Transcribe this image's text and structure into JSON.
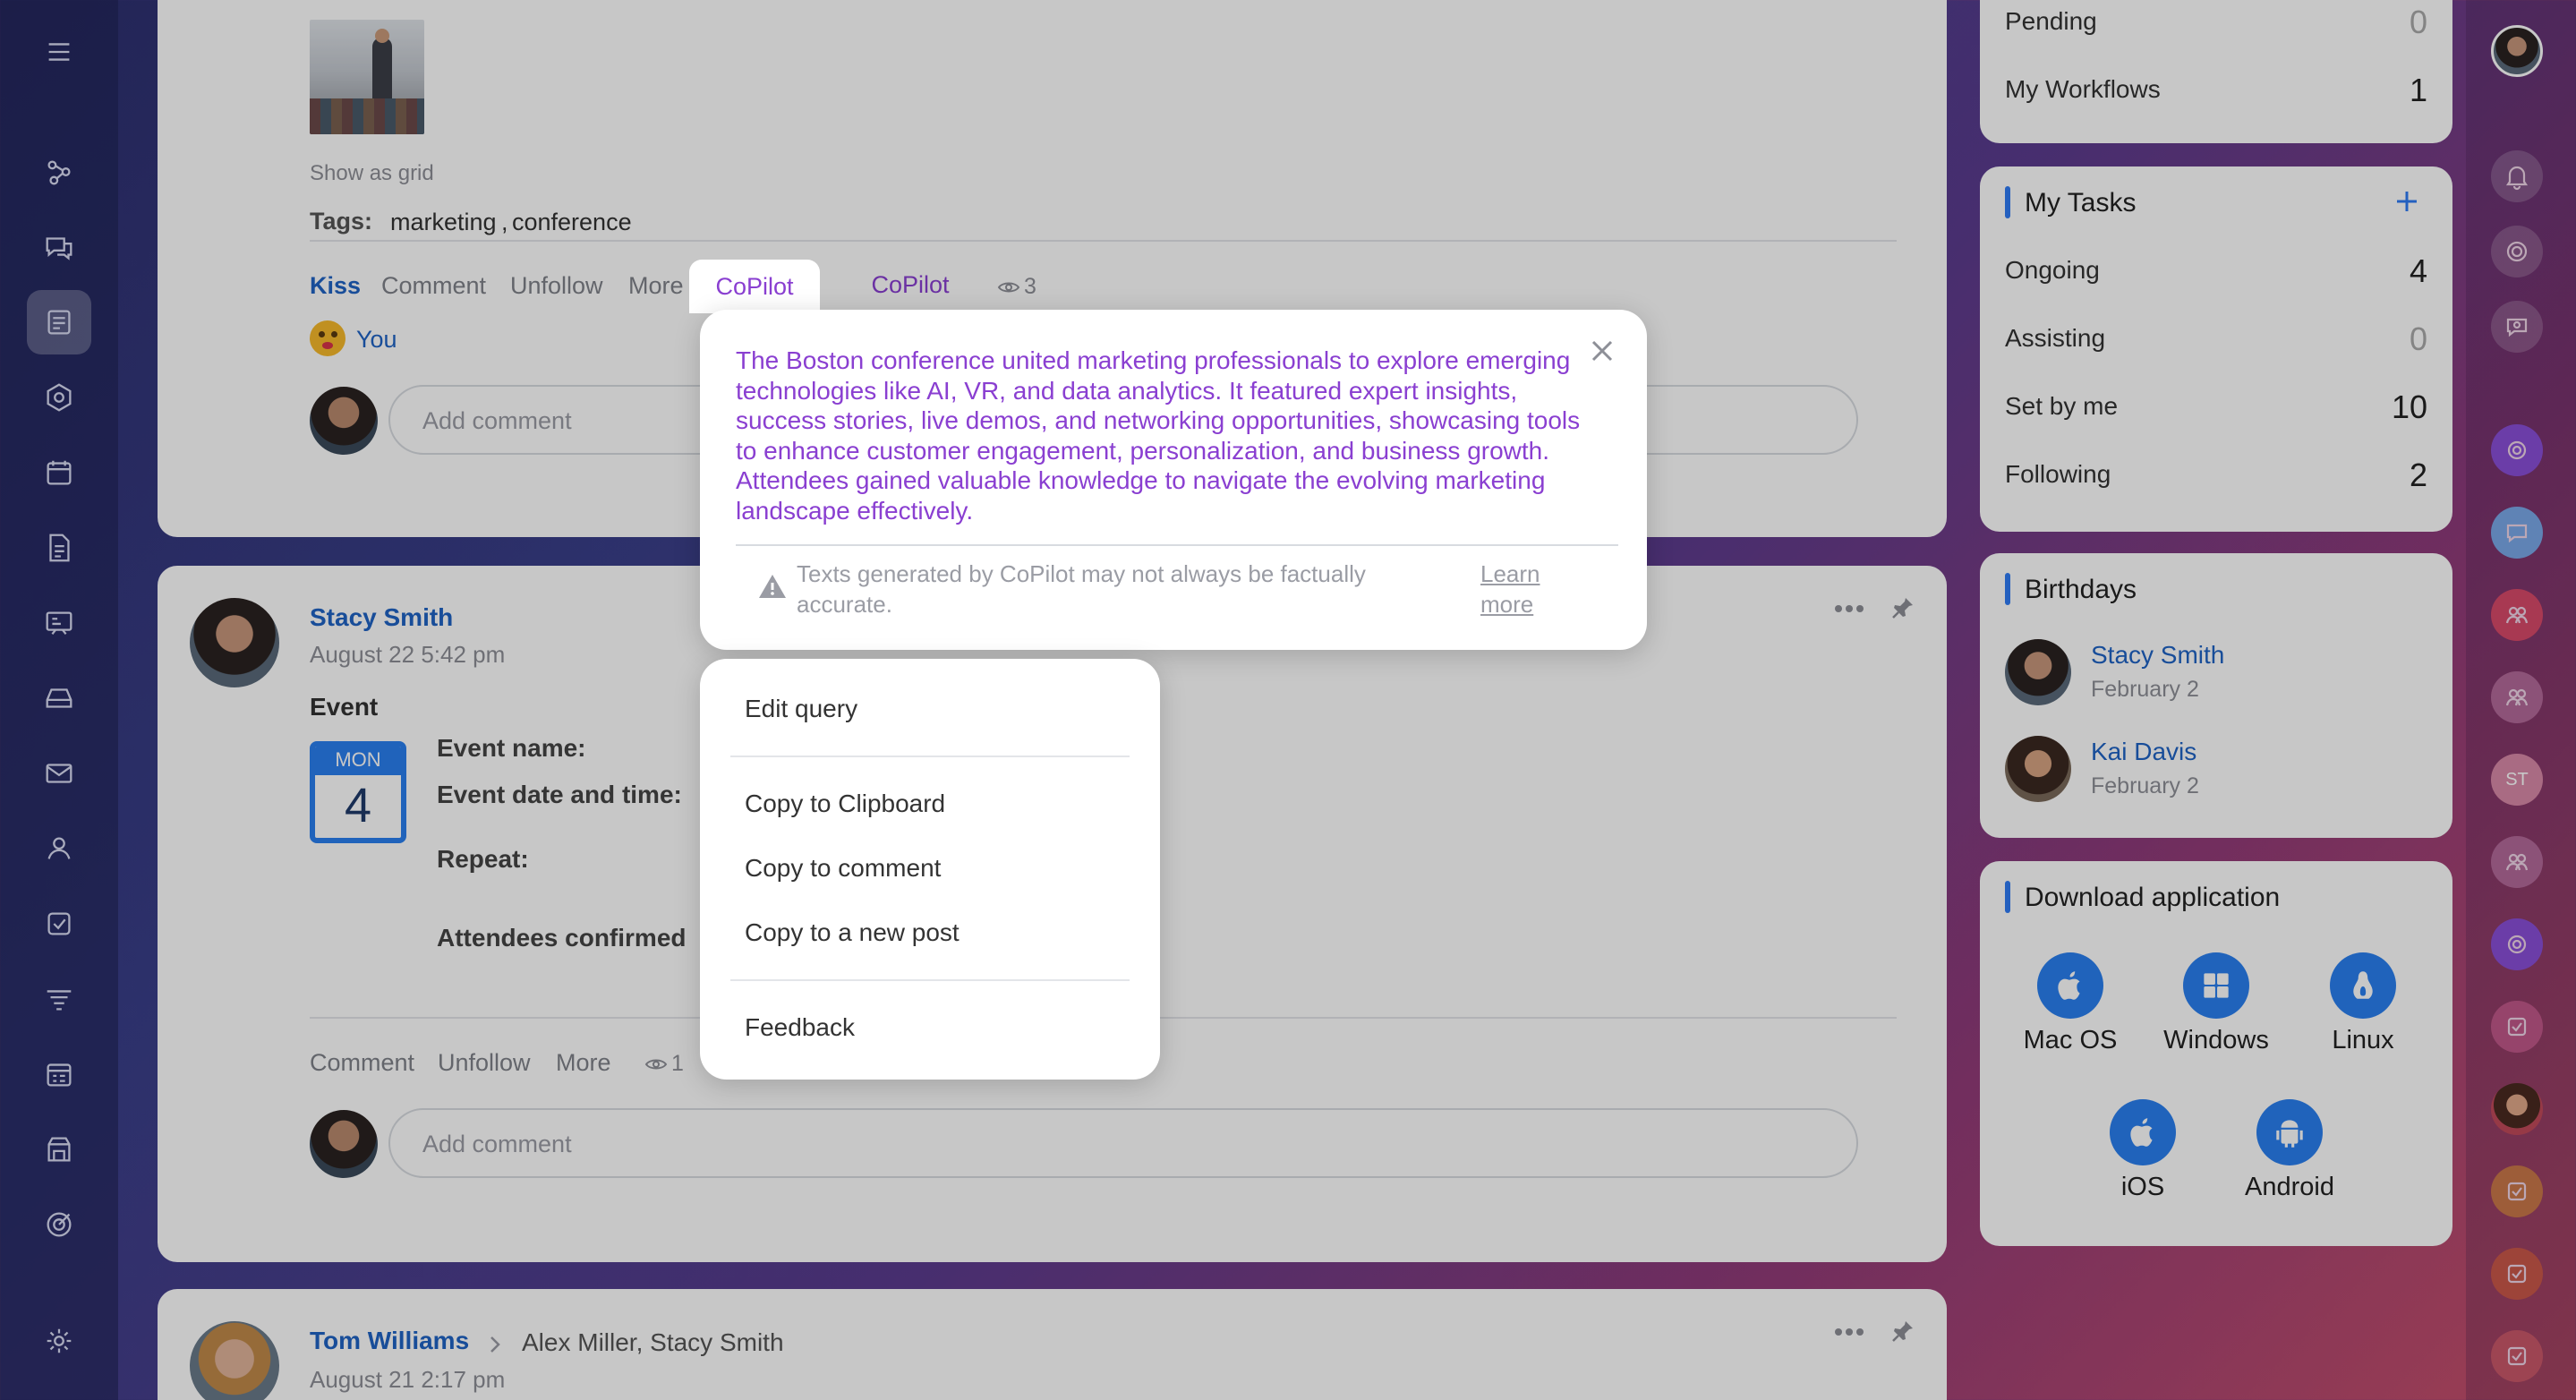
{
  "feed": {
    "post1": {
      "show_as_grid": "Show as grid",
      "tags_label": "Tags:",
      "tags": [
        "marketing",
        "conference"
      ],
      "tag_separator": ",",
      "actions": {
        "kiss": "Kiss",
        "comment": "Comment",
        "unfollow": "Unfollow",
        "more": "More",
        "copilot": "CoPilot",
        "views": "3"
      },
      "reaction_user": "You",
      "comment_placeholder": "Add comment"
    },
    "post2": {
      "author": "Stacy Smith",
      "date": "August 22 5:42 pm",
      "type": "Event",
      "calendar": {
        "day_name": "MON",
        "day_num": "4"
      },
      "fields": {
        "name": "Event name:",
        "datetime": "Event date and time:",
        "repeat": "Repeat:",
        "attendees": "Attendees confirmed"
      },
      "actions": {
        "comment": "Comment",
        "unfollow": "Unfollow",
        "more": "More",
        "views": "1"
      },
      "comment_placeholder": "Add comment"
    },
    "post3": {
      "author": "Tom Williams",
      "recipients": "Alex Miller, Stacy Smith",
      "date": "August 21 2:17 pm"
    }
  },
  "copilot": {
    "text": "The Boston conference united marketing professionals to explore emerging technologies like AI, VR, and data analytics. It featured expert insights, success stories, live demos, and networking opportunities, showcasing tools to enhance customer engagement, personalization, and business growth. Attendees gained valuable knowledge to navigate the evolving marketing landscape effectively.",
    "disclaimer": "Texts generated by CoPilot may not always be factually accurate.",
    "learn_more": "Learn more",
    "menu": {
      "edit_query": "Edit query",
      "copy_clipboard": "Copy to Clipboard",
      "copy_comment": "Copy to comment",
      "copy_post": "Copy to a new post",
      "feedback": "Feedback"
    }
  },
  "workflows": {
    "pending_label": "Pending",
    "pending_count": "0",
    "my_label": "My Workflows",
    "my_count": "1"
  },
  "tasks": {
    "title": "My Tasks",
    "rows": [
      {
        "label": "Ongoing",
        "count": "4"
      },
      {
        "label": "Assisting",
        "count": "0"
      },
      {
        "label": "Set by me",
        "count": "10"
      },
      {
        "label": "Following",
        "count": "2"
      }
    ]
  },
  "birthdays": {
    "title": "Birthdays",
    "people": [
      {
        "name": "Stacy Smith",
        "date": "February 2"
      },
      {
        "name": "Kai Davis",
        "date": "February 2"
      }
    ]
  },
  "download": {
    "title": "Download application",
    "apps": [
      "Mac OS",
      "Windows",
      "Linux",
      "iOS",
      "Android"
    ]
  },
  "right_bar": {
    "initials": "ST"
  },
  "colors": {
    "accent": "#2f7bf5",
    "link": "#1f63c4",
    "copilot_purple": "#8a3fd1"
  }
}
